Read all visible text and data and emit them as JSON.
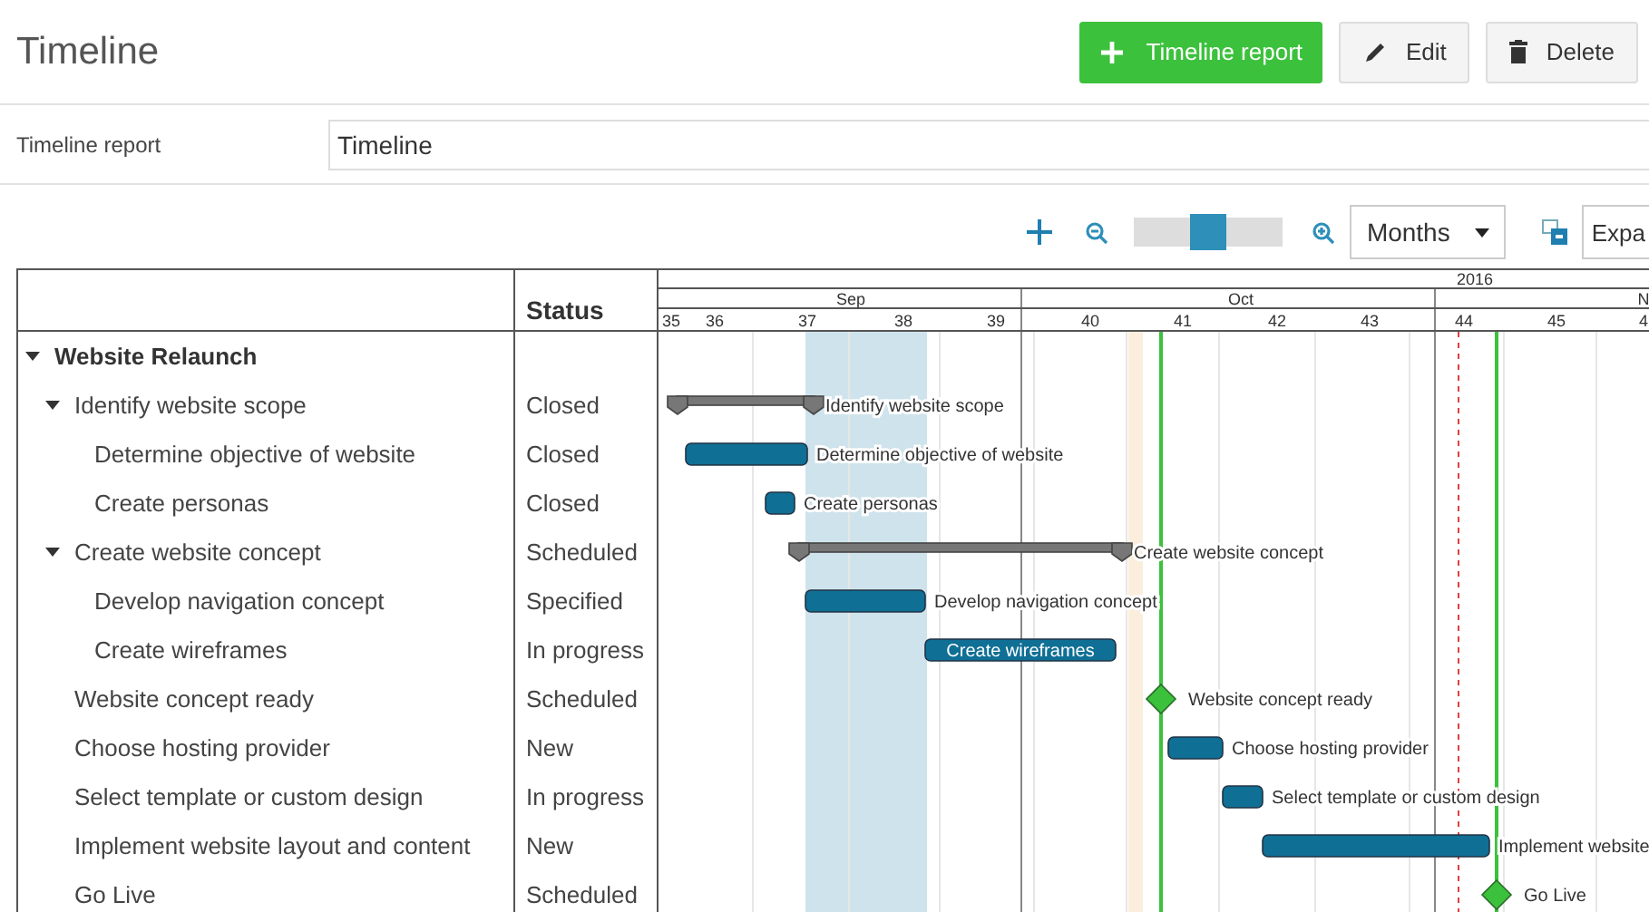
{
  "page": {
    "title": "Timeline"
  },
  "actions": [
    {
      "kind": "add",
      "label": "Timeline report"
    },
    {
      "kind": "edit",
      "label": "Edit"
    },
    {
      "kind": "delete",
      "label": "Delete"
    }
  ],
  "report_field": {
    "label": "Timeline report",
    "value": "Timeline"
  },
  "toolbar": {
    "zoom": {
      "level": 0.5
    },
    "scale": "Months",
    "expand_button": "Expa"
  },
  "table": {
    "status_heading": "Status",
    "rows": [
      {
        "label": "Website Relaunch",
        "kind": "project",
        "expanded": true,
        "children": [
          {
            "label": "Identify website scope",
            "status": "Closed",
            "kind": "summary",
            "expanded": true,
            "bar_label": "Identify website scope",
            "children": [
              {
                "label": "Determine objective of website",
                "status": "Closed",
                "kind": "task",
                "bar_label": "Determine objective of website",
                "label_inside": false
              },
              {
                "label": "Create personas",
                "status": "Closed",
                "kind": "task",
                "bar_label": "Create personas",
                "label_inside": false
              }
            ]
          },
          {
            "label": "Create website concept",
            "status": "Scheduled",
            "kind": "summary",
            "expanded": true,
            "bar_label": "Create website concept",
            "children": [
              {
                "label": "Develop navigation concept",
                "status": "Specified",
                "kind": "task",
                "bar_label": "Develop navigation concept",
                "label_inside": false
              },
              {
                "label": "Create wireframes",
                "status": "In progress",
                "kind": "task",
                "bar_label": "Create wireframes",
                "label_inside": true
              }
            ]
          },
          {
            "label": "Website concept ready",
            "status": "Scheduled",
            "kind": "milestone",
            "bar_label": "Website concept ready"
          },
          {
            "label": "Choose hosting provider",
            "status": "New",
            "kind": "task",
            "bar_label": "Choose hosting provider",
            "label_inside": false
          },
          {
            "label": "Select template or custom design",
            "status": "In progress",
            "kind": "task",
            "bar_label": "Select template or custom design",
            "label_inside": false
          },
          {
            "label": "Implement website layout and content",
            "status": "New",
            "kind": "task",
            "bar_label": "Implement website",
            "label_inside": false
          },
          {
            "label": "Go Live",
            "status": "Scheduled",
            "kind": "milestone",
            "bar_label": "Go Live"
          }
        ]
      }
    ]
  },
  "timeline": {
    "year": "2016",
    "months": [
      "Sep",
      "Oct",
      "N"
    ],
    "weeks": [
      "35",
      "36",
      "37",
      "38",
      "39",
      "40",
      "41",
      "42",
      "43",
      "44",
      "45",
      "4"
    ]
  }
}
